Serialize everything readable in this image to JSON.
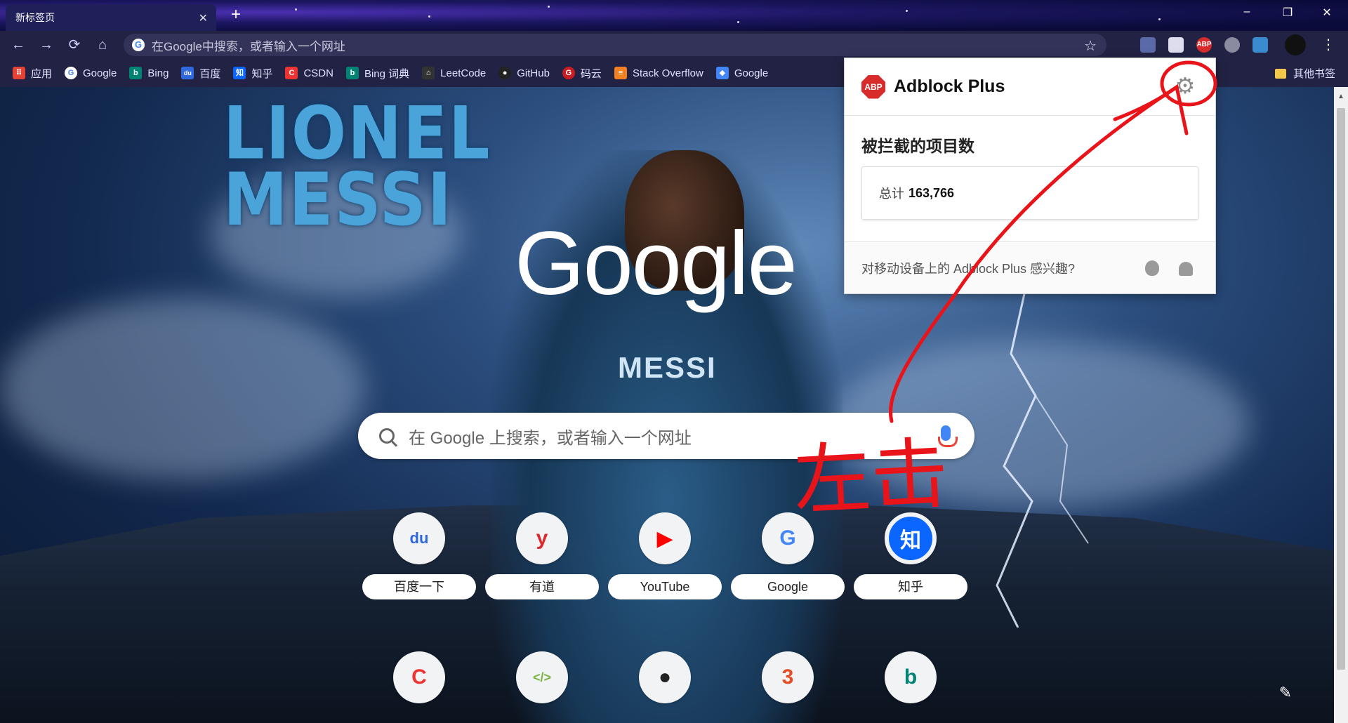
{
  "tab": {
    "title": "新标签页",
    "close": "✕",
    "new_tab": "+"
  },
  "window_controls": {
    "minimize": "–",
    "maximize": "❐",
    "close": "✕"
  },
  "toolbar": {
    "back": "←",
    "forward": "→",
    "reload": "⟳",
    "home": "⌂",
    "omnibox_placeholder": "在Google中搜索，或者输入一个网址",
    "bookmark_star": "☆",
    "extensions": [
      {
        "name": "ext-1",
        "color": "#5a6aa8"
      },
      {
        "name": "ext-2",
        "color": "#dde"
      },
      {
        "name": "abp",
        "label": "ABP",
        "color": "#d82b2b"
      },
      {
        "name": "ext-4",
        "color": "#8a8aa0"
      },
      {
        "name": "ext-5",
        "color": "#3a8bd0"
      }
    ],
    "menu": "⋮"
  },
  "bookmarks": {
    "items": [
      {
        "label": "应用",
        "icon_color": "#e34234",
        "icon": "⠿"
      },
      {
        "label": "Google",
        "icon_color": "#ffffff",
        "icon": "G"
      },
      {
        "label": "Bing",
        "icon_color": "#008373",
        "icon": "b"
      },
      {
        "label": "百度",
        "icon_color": "#3068e0",
        "icon": "du"
      },
      {
        "label": "知乎",
        "icon_color": "#0a66ff",
        "icon": "知"
      },
      {
        "label": "CSDN",
        "icon_color": "#e33",
        "icon": "C"
      },
      {
        "label": "Bing 词典",
        "icon_color": "#008373",
        "icon": "b"
      },
      {
        "label": "LeetCode",
        "icon_color": "#333",
        "icon": "⌂"
      },
      {
        "label": "GitHub",
        "icon_color": "#222",
        "icon": "●"
      },
      {
        "label": "码云",
        "icon_color": "#c71d23",
        "icon": "G"
      },
      {
        "label": "Stack Overflow",
        "icon_color": "#f48024",
        "icon": "≡"
      },
      {
        "label": "Google",
        "icon_color": "#4285f4",
        "icon": "◆"
      }
    ],
    "other": "其他书签"
  },
  "page": {
    "background_title_line1": "LIONEL",
    "background_title_line2": "MESSI",
    "jersey_name": "MESSI",
    "google_logo": "Google",
    "search_placeholder": "在 Google 上搜索，或者输入一个网址",
    "tiles_row1": [
      {
        "label": "百度一下",
        "icon": "du",
        "color": "#3068e0"
      },
      {
        "label": "有道",
        "icon": "y",
        "color": "#e0262d"
      },
      {
        "label": "YouTube",
        "icon": "▶",
        "color": "#ff0000"
      },
      {
        "label": "Google",
        "icon": "G",
        "color": "#4285f4"
      },
      {
        "label": "知乎",
        "icon": "知",
        "color": "#0a66ff"
      }
    ],
    "tiles_row2": [
      {
        "icon": "C",
        "color": "#e33"
      },
      {
        "icon": "</>",
        "color": "#7cb342"
      },
      {
        "icon": "●",
        "color": "#222"
      },
      {
        "icon": "3",
        "color": "#e44d26"
      },
      {
        "icon": "b",
        "color": "#008373"
      }
    ],
    "edit_icon": "✎"
  },
  "abp_popup": {
    "logo": "ABP",
    "title": "Adblock Plus",
    "gear": "⚙",
    "blocked_heading": "被拦截的项目数",
    "total_label": "总计",
    "total_value": "163,766",
    "footer_text": "对移动设备上的 Adblock Plus 感兴趣?"
  },
  "annotation": {
    "text": "左击",
    "color": "#e8141a"
  }
}
